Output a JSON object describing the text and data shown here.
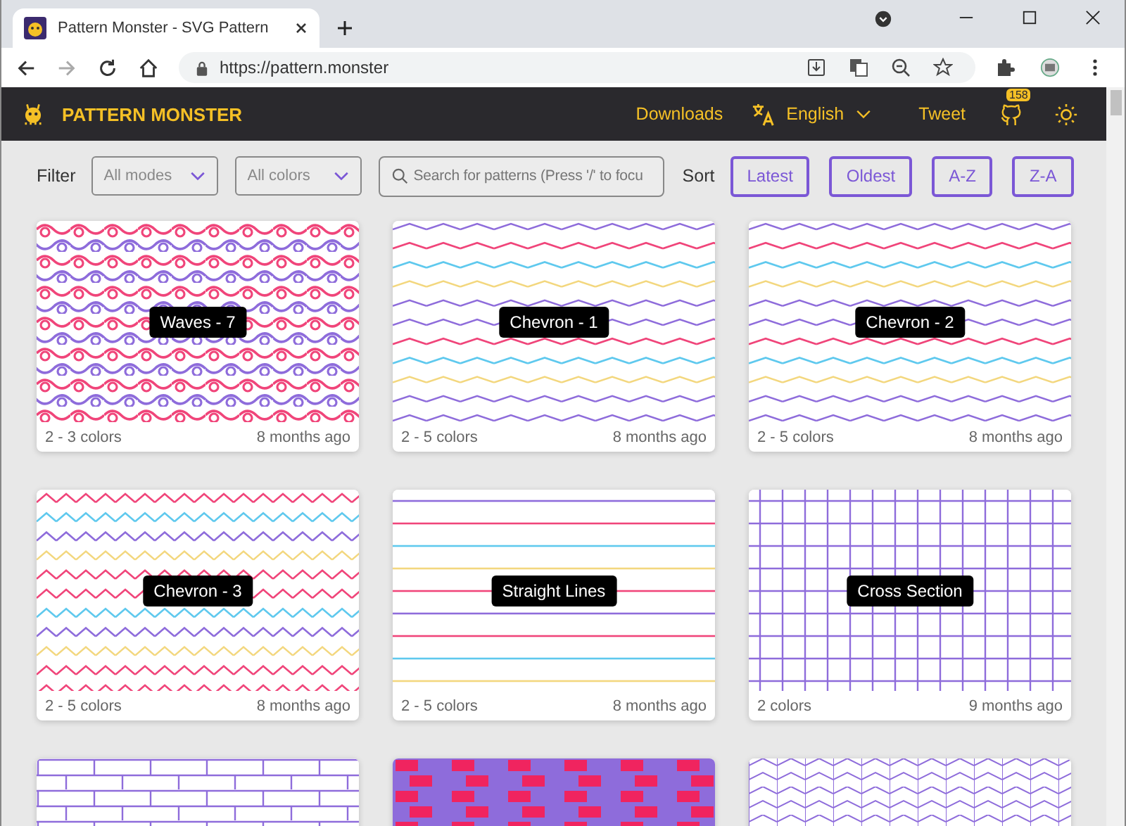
{
  "browser": {
    "tab_title": "Pattern Monster - SVG Pattern",
    "url": "https://pattern.monster"
  },
  "header": {
    "brand": "PATTERN MONSTER",
    "nav": [
      {
        "label": "Downloads",
        "kind": "link"
      },
      {
        "label": "English",
        "kind": "language"
      },
      {
        "label": "Tweet",
        "kind": "link"
      }
    ],
    "star_count": "158"
  },
  "filters": {
    "label": "Filter",
    "mode": "All modes",
    "color_filter": "All colors",
    "search_placeholder": "Search for patterns (Press '/' to focu",
    "sort_label": "Sort",
    "sort_options": [
      "Latest",
      "Oldest",
      "A-Z",
      "Z-A"
    ]
  },
  "patterns": [
    {
      "kind": "waves",
      "title": "Waves - 7",
      "colors": "2 - 3 colors",
      "age": "8 months ago"
    },
    {
      "kind": "chevron-soft",
      "title": "Chevron - 1",
      "colors": "2 - 5 colors",
      "age": "8 months ago"
    },
    {
      "kind": "chevron-soft",
      "title": "Chevron - 2",
      "colors": "2 - 5 colors",
      "age": "8 months ago"
    },
    {
      "kind": "chevron",
      "title": "Chevron - 3",
      "colors": "2 - 5 colors",
      "age": "8 months ago"
    },
    {
      "kind": "lines",
      "title": "Straight Lines",
      "colors": "2 - 5 colors",
      "age": "8 months ago"
    },
    {
      "kind": "grid",
      "title": "Cross Section",
      "colors": "2 colors",
      "age": "9 months ago"
    },
    {
      "kind": "bricks"
    },
    {
      "kind": "bricks-filled"
    },
    {
      "kind": "herringbone"
    }
  ]
}
